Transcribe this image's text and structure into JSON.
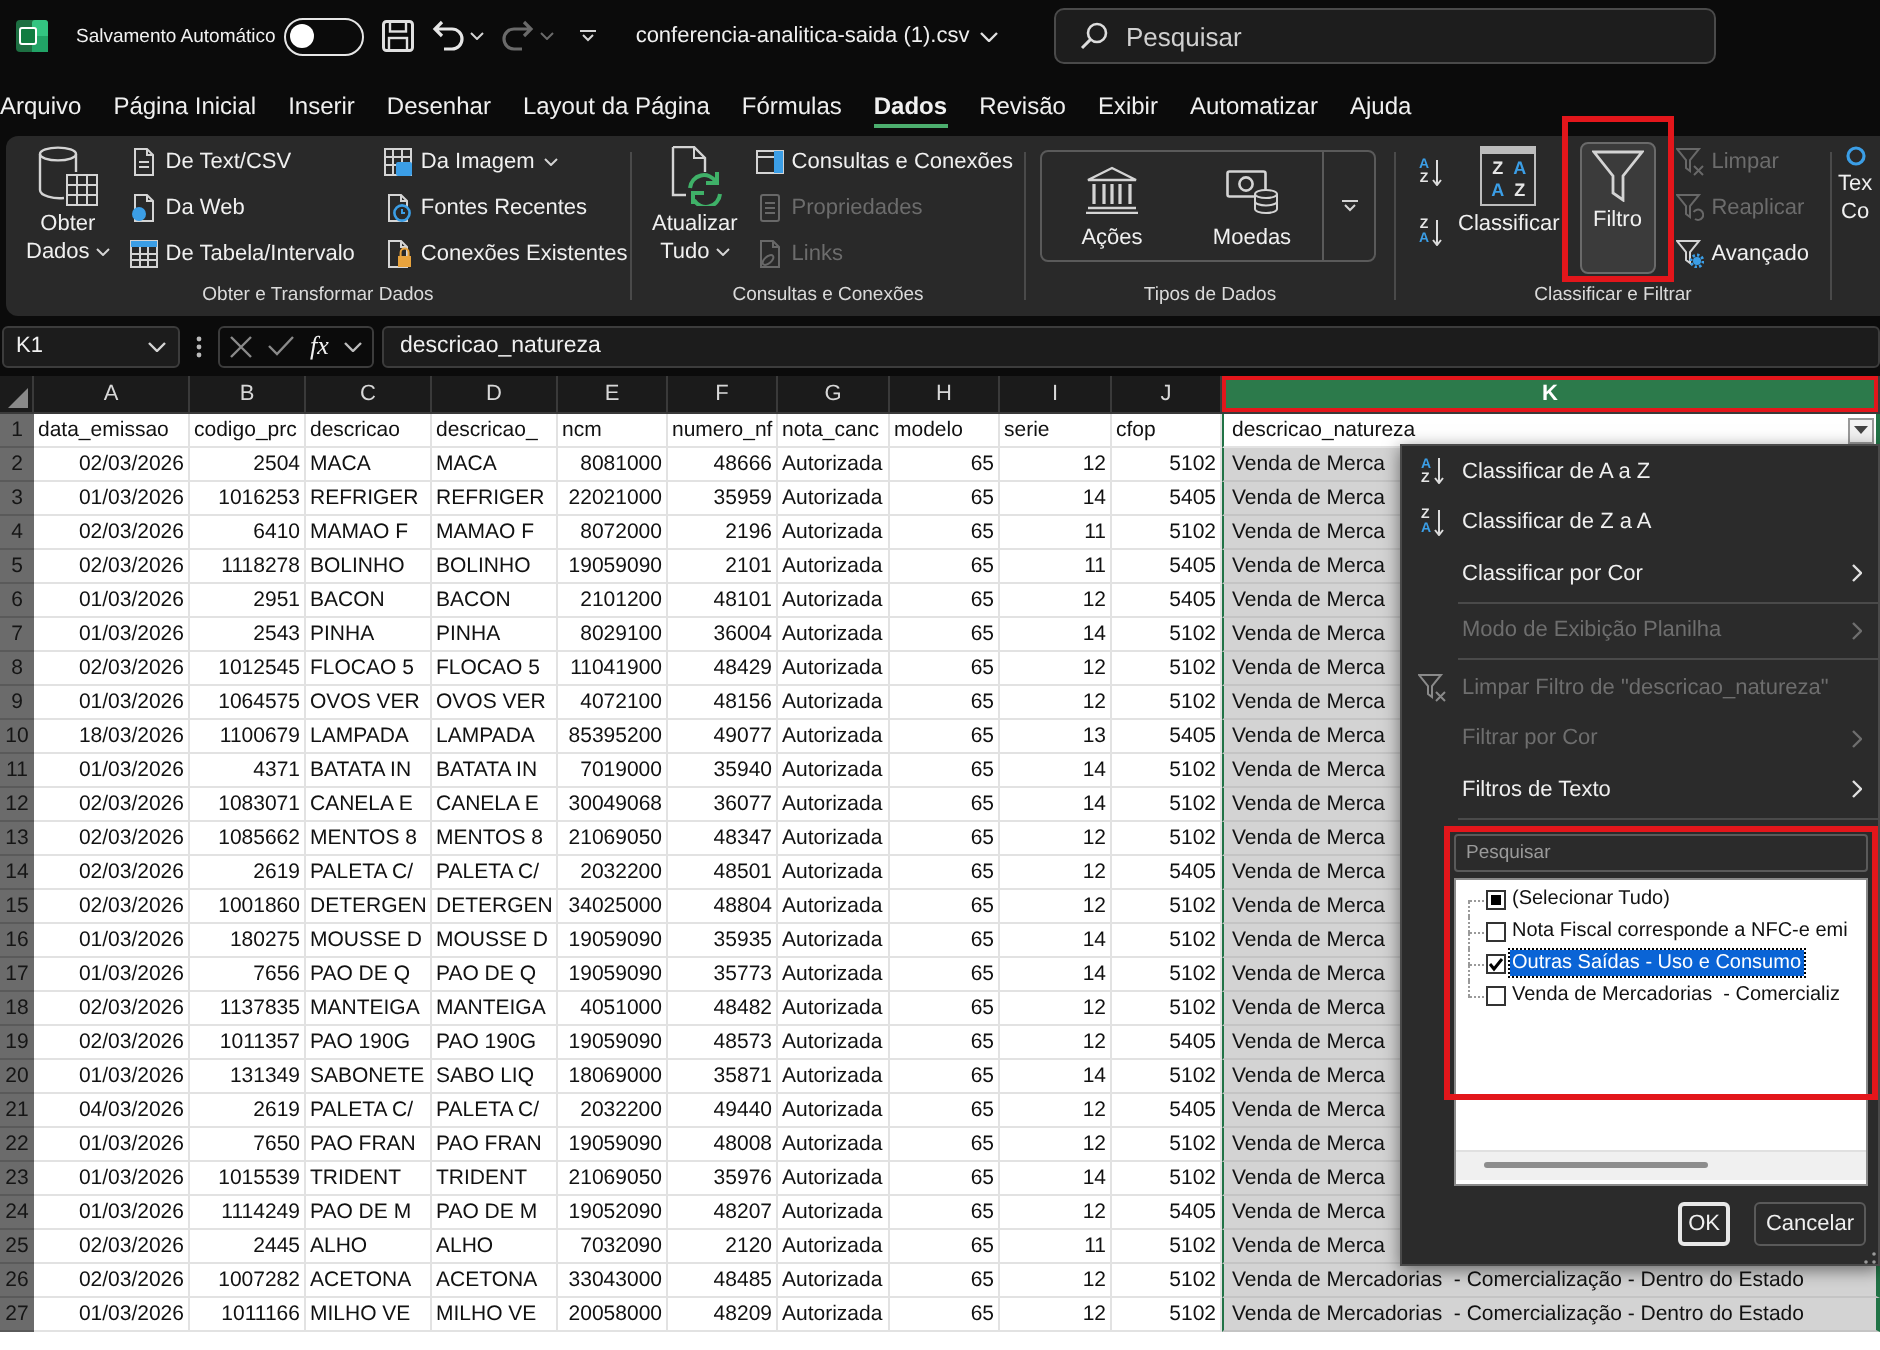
{
  "title_bar": {
    "autosave_label": "Salvamento Automático",
    "autosave_on": false,
    "file_name": "conferencia-analitica-saida (1).csv",
    "search": {
      "placeholder": "Pesquisar"
    }
  },
  "menu_tabs": [
    {
      "label": "Arquivo",
      "selected": false
    },
    {
      "label": "Página Inicial",
      "selected": false
    },
    {
      "label": "Inserir",
      "selected": false
    },
    {
      "label": "Desenhar",
      "selected": false
    },
    {
      "label": "Layout da Página",
      "selected": false
    },
    {
      "label": "Fórmulas",
      "selected": false
    },
    {
      "label": "Dados",
      "selected": true
    },
    {
      "label": "Revisão",
      "selected": false
    },
    {
      "label": "Exibir",
      "selected": false
    },
    {
      "label": "Automatizar",
      "selected": false
    },
    {
      "label": "Ajuda",
      "selected": false
    }
  ],
  "ribbon": {
    "groups": [
      {
        "label": "Obter e Transformar Dados",
        "items": [
          {
            "kind": "large",
            "lines": [
              "Obter",
              "Dados"
            ],
            "dropdown": true,
            "pressed": false,
            "highlighted": false
          },
          {
            "kind": "stack",
            "buttons": [
              {
                "label": "De Text/CSV",
                "disabled": false
              },
              {
                "label": "Da Web",
                "disabled": false
              },
              {
                "label": "De Tabela/Intervalo",
                "disabled": false
              }
            ]
          },
          {
            "kind": "stack",
            "buttons": [
              {
                "label": "Da Imagem",
                "disabled": false,
                "dropdown": true
              },
              {
                "label": "Fontes Recentes",
                "disabled": false
              },
              {
                "label": "Conexões Existentes",
                "disabled": false
              }
            ]
          }
        ]
      },
      {
        "label": "Consultas e Conexões",
        "items": [
          {
            "kind": "large",
            "lines": [
              "Atualizar",
              "Tudo"
            ],
            "dropdown": true,
            "pressed": false,
            "highlighted": false
          },
          {
            "kind": "stack",
            "buttons": [
              {
                "label": "Consultas e Conexões",
                "disabled": false
              },
              {
                "label": "Propriedades",
                "disabled": true
              },
              {
                "label": "Links",
                "disabled": true
              }
            ]
          }
        ]
      },
      {
        "label": "Tipos de Dados",
        "items": [
          {
            "kind": "gallery",
            "buttons": [
              {
                "label": "Ações"
              },
              {
                "label": "Moedas"
              }
            ]
          }
        ]
      },
      {
        "label": "Classificar e Filtrar",
        "items": [
          {
            "kind": "sort_pair",
            "buttons": [
              {
                "kind": "ascending",
                "glyphs": [
                  "A",
                  "Z"
                ]
              },
              {
                "kind": "descending",
                "glyphs": [
                  "Z",
                  "A"
                ]
              }
            ]
          },
          {
            "kind": "large",
            "lines": [
              "Classificar"
            ],
            "glyphs": [
              "Z",
              "A",
              "A",
              "Z"
            ],
            "pressed": false,
            "highlighted": false
          },
          {
            "kind": "large",
            "lines": [
              "Filtro"
            ],
            "pressed": true,
            "highlighted": true
          },
          {
            "kind": "stack",
            "buttons": [
              {
                "label": "Limpar",
                "disabled": true
              },
              {
                "label": "Reaplicar",
                "disabled": true
              },
              {
                "label": "Avançado",
                "disabled": false
              }
            ]
          }
        ]
      },
      {
        "items": [
          {
            "kind": "large",
            "lines": [
              "Tex",
              "Co"
            ],
            "pressed": false,
            "highlighted": false
          }
        ]
      }
    ]
  },
  "formula_bar": {
    "name_box": "K1",
    "function_label": "fx",
    "formula": "descricao_natureza"
  },
  "sheet": {
    "columns": [
      {
        "letter": "A",
        "kind": "number",
        "selected": false,
        "filter_button": false,
        "highlighted": false
      },
      {
        "letter": "B",
        "kind": "number",
        "selected": false,
        "filter_button": false,
        "highlighted": false
      },
      {
        "letter": "C",
        "kind": "text",
        "selected": false,
        "filter_button": false,
        "highlighted": false
      },
      {
        "letter": "D",
        "kind": "text",
        "selected": false,
        "filter_button": false,
        "highlighted": false
      },
      {
        "letter": "E",
        "kind": "number",
        "selected": false,
        "filter_button": false,
        "highlighted": false
      },
      {
        "letter": "F",
        "kind": "number",
        "selected": false,
        "filter_button": false,
        "highlighted": false
      },
      {
        "letter": "G",
        "kind": "text",
        "selected": false,
        "filter_button": false,
        "highlighted": false
      },
      {
        "letter": "H",
        "kind": "number",
        "selected": false,
        "filter_button": false,
        "highlighted": false
      },
      {
        "letter": "I",
        "kind": "number",
        "selected": false,
        "filter_button": false,
        "highlighted": false
      },
      {
        "letter": "J",
        "kind": "number",
        "selected": false,
        "filter_button": false,
        "highlighted": false
      },
      {
        "letter": "K",
        "kind": "text",
        "selected": true,
        "filter_button": true,
        "highlighted": true
      }
    ],
    "rows": [
      {
        "number": "1",
        "kind": "header",
        "active": true,
        "cells": [
          "data_emissao",
          "codigo_prc",
          "descricao",
          "descricao_",
          "ncm",
          "numero_nf",
          "nota_canc",
          "modelo",
          "serie",
          "cfop",
          "descricao_natureza"
        ]
      },
      {
        "number": "2",
        "kind": "data",
        "active": false,
        "cells": [
          "02/03/2026",
          "2504",
          "MACA",
          "MACA",
          "8081000",
          "48666",
          "Autorizada",
          "65",
          "12",
          "5102",
          "Venda de Merca"
        ]
      },
      {
        "number": "3",
        "kind": "data",
        "active": false,
        "cells": [
          "01/03/2026",
          "1016253",
          "REFRIGER",
          "REFRIGER",
          "22021000",
          "35959",
          "Autorizada",
          "65",
          "14",
          "5405",
          "Venda de Merca"
        ]
      },
      {
        "number": "4",
        "kind": "data",
        "active": false,
        "cells": [
          "02/03/2026",
          "6410",
          "MAMAO F",
          "MAMAO F",
          "8072000",
          "2196",
          "Autorizada",
          "65",
          "11",
          "5102",
          "Venda de Merca"
        ]
      },
      {
        "number": "5",
        "kind": "data",
        "active": false,
        "cells": [
          "02/03/2026",
          "1118278",
          "BOLINHO",
          "BOLINHO",
          "19059090",
          "2101",
          "Autorizada",
          "65",
          "11",
          "5405",
          "Venda de Merca"
        ]
      },
      {
        "number": "6",
        "kind": "data",
        "active": false,
        "cells": [
          "01/03/2026",
          "2951",
          "BACON",
          "BACON",
          "2101200",
          "48101",
          "Autorizada",
          "65",
          "12",
          "5405",
          "Venda de Merca"
        ]
      },
      {
        "number": "7",
        "kind": "data",
        "active": false,
        "cells": [
          "01/03/2026",
          "2543",
          "PINHA",
          "PINHA",
          "8029100",
          "36004",
          "Autorizada",
          "65",
          "14",
          "5102",
          "Venda de Merca"
        ]
      },
      {
        "number": "8",
        "kind": "data",
        "active": false,
        "cells": [
          "02/03/2026",
          "1012545",
          "FLOCAO 5",
          "FLOCAO 5",
          "11041900",
          "48429",
          "Autorizada",
          "65",
          "12",
          "5102",
          "Venda de Merca"
        ]
      },
      {
        "number": "9",
        "kind": "data",
        "active": false,
        "cells": [
          "01/03/2026",
          "1064575",
          "OVOS VER",
          "OVOS VER",
          "4072100",
          "48156",
          "Autorizada",
          "65",
          "12",
          "5102",
          "Venda de Merca"
        ]
      },
      {
        "number": "10",
        "kind": "data",
        "active": false,
        "cells": [
          "18/03/2026",
          "1100679",
          "LAMPADA",
          "LAMPADA",
          "85395200",
          "49077",
          "Autorizada",
          "65",
          "13",
          "5405",
          "Venda de Merca"
        ]
      },
      {
        "number": "11",
        "kind": "data",
        "active": false,
        "cells": [
          "01/03/2026",
          "4371",
          "BATATA IN",
          "BATATA IN",
          "7019000",
          "35940",
          "Autorizada",
          "65",
          "14",
          "5102",
          "Venda de Merca"
        ]
      },
      {
        "number": "12",
        "kind": "data",
        "active": false,
        "cells": [
          "02/03/2026",
          "1083071",
          "CANELA E",
          "CANELA E",
          "30049068",
          "36077",
          "Autorizada",
          "65",
          "14",
          "5102",
          "Venda de Merca"
        ]
      },
      {
        "number": "13",
        "kind": "data",
        "active": false,
        "cells": [
          "02/03/2026",
          "1085662",
          "MENTOS 8",
          "MENTOS 8",
          "21069050",
          "48347",
          "Autorizada",
          "65",
          "12",
          "5102",
          "Venda de Merca"
        ]
      },
      {
        "number": "14",
        "kind": "data",
        "active": false,
        "cells": [
          "02/03/2026",
          "2619",
          "PALETA C/",
          "PALETA C/",
          "2032200",
          "48501",
          "Autorizada",
          "65",
          "12",
          "5405",
          "Venda de Merca"
        ]
      },
      {
        "number": "15",
        "kind": "data",
        "active": false,
        "cells": [
          "02/03/2026",
          "1001860",
          "DETERGEN",
          "DETERGEN",
          "34025000",
          "48804",
          "Autorizada",
          "65",
          "12",
          "5102",
          "Venda de Merca"
        ]
      },
      {
        "number": "16",
        "kind": "data",
        "active": false,
        "cells": [
          "01/03/2026",
          "180275",
          "MOUSSE D",
          "MOUSSE D",
          "19059090",
          "35935",
          "Autorizada",
          "65",
          "14",
          "5102",
          "Venda de Merca"
        ]
      },
      {
        "number": "17",
        "kind": "data",
        "active": false,
        "cells": [
          "01/03/2026",
          "7656",
          "PAO DE Q",
          "PAO DE Q",
          "19059090",
          "35773",
          "Autorizada",
          "65",
          "14",
          "5102",
          "Venda de Merca"
        ]
      },
      {
        "number": "18",
        "kind": "data",
        "active": false,
        "cells": [
          "02/03/2026",
          "1137835",
          "MANTEIGA",
          "MANTEIGA",
          "4051000",
          "48482",
          "Autorizada",
          "65",
          "12",
          "5102",
          "Venda de Merca"
        ]
      },
      {
        "number": "19",
        "kind": "data",
        "active": false,
        "cells": [
          "02/03/2026",
          "1011357",
          "PAO 190G",
          "PAO 190G",
          "19059090",
          "48573",
          "Autorizada",
          "65",
          "12",
          "5405",
          "Venda de Merca"
        ]
      },
      {
        "number": "20",
        "kind": "data",
        "active": false,
        "cells": [
          "01/03/2026",
          "131349",
          "SABONETE",
          "SABO LIQ",
          "18069000",
          "35871",
          "Autorizada",
          "65",
          "14",
          "5102",
          "Venda de Merca"
        ]
      },
      {
        "number": "21",
        "kind": "data",
        "active": false,
        "cells": [
          "04/03/2026",
          "2619",
          "PALETA C/",
          "PALETA C/",
          "2032200",
          "49440",
          "Autorizada",
          "65",
          "12",
          "5405",
          "Venda de Merca"
        ]
      },
      {
        "number": "22",
        "kind": "data",
        "active": false,
        "cells": [
          "01/03/2026",
          "7650",
          "PAO FRAN",
          "PAO FRAN",
          "19059090",
          "48008",
          "Autorizada",
          "65",
          "12",
          "5102",
          "Venda de Merca"
        ]
      },
      {
        "number": "23",
        "kind": "data",
        "active": false,
        "cells": [
          "01/03/2026",
          "1015539",
          "TRIDENT",
          "TRIDENT",
          "21069050",
          "35976",
          "Autorizada",
          "65",
          "14",
          "5102",
          "Venda de Merca"
        ]
      },
      {
        "number": "24",
        "kind": "data",
        "active": false,
        "cells": [
          "01/03/2026",
          "1114249",
          "PAO DE M",
          "PAO DE M",
          "19052090",
          "48207",
          "Autorizada",
          "65",
          "12",
          "5405",
          "Venda de Merca"
        ]
      },
      {
        "number": "25",
        "kind": "data",
        "active": false,
        "cells": [
          "02/03/2026",
          "2445",
          "ALHO",
          "ALHO",
          "7032090",
          "2120",
          "Autorizada",
          "65",
          "11",
          "5102",
          "Venda de Merca"
        ]
      },
      {
        "number": "26",
        "kind": "data",
        "active": false,
        "cells": [
          "02/03/2026",
          "1007282",
          "ACETONA",
          "ACETONA",
          "33043000",
          "48485",
          "Autorizada",
          "65",
          "12",
          "5102",
          "Venda de Mercadorias  - Comercialização - Dentro do Estado"
        ]
      },
      {
        "number": "27",
        "kind": "data",
        "active": false,
        "cells": [
          "01/03/2026",
          "1011166",
          "MILHO VE",
          "MILHO VE",
          "20058000",
          "48209",
          "Autorizada",
          "65",
          "12",
          "5102",
          "Venda de Mercadorias  - Comercialização - Dentro do Estado"
        ]
      }
    ]
  },
  "filter_menu": {
    "items": [
      {
        "kind": "sort_ascending",
        "label": "Classificar de A a Z",
        "glyphs": [
          "A",
          "Z"
        ],
        "disabled": false,
        "submenu": false
      },
      {
        "kind": "sort_descending",
        "label": "Classificar de Z a A",
        "glyphs": [
          "Z",
          "A"
        ],
        "disabled": false,
        "submenu": false
      },
      {
        "kind": "command",
        "label": "Classificar por Cor",
        "disabled": false,
        "submenu": true
      },
      {
        "kind": "separator"
      },
      {
        "kind": "command",
        "label": "Modo de Exibição Planilha",
        "disabled": true,
        "submenu": true
      },
      {
        "kind": "separator"
      },
      {
        "kind": "clear_filter",
        "label": "Limpar Filtro de \"descricao_natureza\"",
        "disabled": true,
        "submenu": false
      },
      {
        "kind": "command",
        "label": "Filtrar por Cor",
        "disabled": true,
        "submenu": true
      },
      {
        "kind": "command",
        "label": "Filtros de Texto",
        "disabled": false,
        "submenu": true
      },
      {
        "kind": "separator"
      }
    ],
    "search": {
      "placeholder": "Pesquisar"
    },
    "highlighted": true,
    "values": [
      {
        "label": "(Selecionar Tudo)",
        "checked": false,
        "indeterminate": true,
        "selected": false
      },
      {
        "label": "Nota Fiscal corresponde a NFC-e emi",
        "checked": false,
        "indeterminate": false,
        "selected": false
      },
      {
        "label": "Outras Saídas - Uso e Consumo",
        "checked": true,
        "indeterminate": false,
        "selected": true
      },
      {
        "label": "Venda de Mercadorias  - Comercializ",
        "checked": false,
        "indeterminate": false,
        "selected": false
      }
    ],
    "buttons": [
      {
        "label": "OK",
        "default": true
      },
      {
        "label": "Cancelar",
        "default": false
      }
    ]
  }
}
